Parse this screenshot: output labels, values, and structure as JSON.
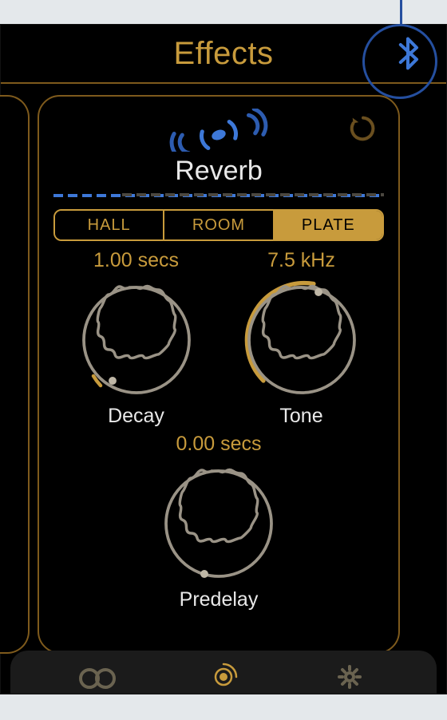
{
  "header": {
    "title": "Effects"
  },
  "card": {
    "effect_name": "Reverb",
    "modes": [
      "HALL",
      "ROOM",
      "PLATE"
    ],
    "active_mode_index": 2,
    "knobs": {
      "decay": {
        "value": "1.00 secs",
        "label": "Decay"
      },
      "tone": {
        "value": "7.5 kHz",
        "label": "Tone"
      },
      "predelay": {
        "value": "0.00 secs",
        "label": "Predelay"
      }
    }
  },
  "pager": {
    "count": 3,
    "active": 2
  },
  "colors": {
    "accent": "#c89b3c",
    "blue": "#3d78d8",
    "text": "#e9e9e9"
  }
}
